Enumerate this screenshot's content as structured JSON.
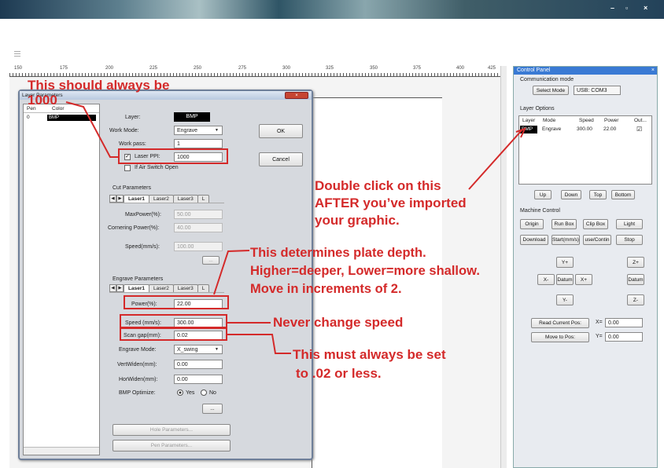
{
  "window": {
    "controls": [
      "–",
      "▫",
      "×"
    ]
  },
  "ruler": {
    "ticks": [
      "150",
      "175",
      "200",
      "225",
      "250",
      "275",
      "300",
      "325",
      "350",
      "375",
      "400",
      "425"
    ]
  },
  "control_panel": {
    "title": "Control Panel",
    "close": "×",
    "comm_mode_label": "Communication mode",
    "select_mode": "Select Mode",
    "port": "USB: COM3",
    "layer_options_label": "Layer Options",
    "layer_headers": [
      "Layer",
      "Mode",
      "Speed",
      "Power",
      "Out..."
    ],
    "layer_row": {
      "layer": "BMP",
      "mode": "Engrave",
      "speed": "300.00",
      "power": "22.00",
      "out": "☑"
    },
    "up": "Up",
    "down": "Down",
    "top": "Top",
    "bottom": "Bottom",
    "machine_control_label": "Machine Control",
    "origin": "Origin",
    "run_box": "Run Box",
    "clip_box": "Clip Box",
    "light": "Light",
    "download": "Download",
    "start": "Start(mm/s)",
    "pause": "use/Contin",
    "stop": "Stop",
    "y_plus": "Y+",
    "z_plus": "Z+",
    "x_minus": "X-",
    "datum": "Datum",
    "x_plus": "X+",
    "datum2": "Datum",
    "y_minus": "Y-",
    "z_minus": "Z-",
    "read_pos": "Read Current Pos:",
    "move_pos": "Move to Pos:",
    "x_label": "X=",
    "x_val": "0.00",
    "y_label": "Y=",
    "y_val": "0.00"
  },
  "dialog": {
    "title": "Layer Parameters",
    "close": "×",
    "pen_header": "Pen",
    "color_header": "Color",
    "pen_row_pen": "0",
    "pen_row_color": "BMP",
    "layer_label": "Layer:",
    "layer_val": "BMP",
    "work_mode_label": "Work Mode:",
    "work_mode_val": "Engrave",
    "work_pass_label": "Work pass:",
    "work_pass_val": "1",
    "laser_ppi_label": "Laser PPI:",
    "laser_ppi_val": "1000",
    "air_switch_label": "If Air Switch Open",
    "ok": "OK",
    "cancel": "Cancel",
    "cut_params_label": "Cut Parameters",
    "tabs": [
      "Laser1",
      "Laser2",
      "Laser3",
      "L"
    ],
    "max_power_label": "MaxPower(%):",
    "max_power_val": "50.00",
    "corner_power_label": "Cornering Power(%):",
    "corner_power_val": "40.00",
    "speed_cut_label": "Speed(mm/s):",
    "speed_cut_val": "100.00",
    "ellipsis": "...",
    "engrave_params_label": "Engrave Parameters",
    "power_label": "Power(%):",
    "power_val": "22.00",
    "speed_label": "Speed (mm/s):",
    "speed_val": "300.00",
    "scan_gap_label": "Scan gap(mm):",
    "scan_gap_val": "0.02",
    "engrave_mode_label": "Engrave Mode:",
    "engrave_mode_val": "X_swing",
    "vert_label": "VertWiden(mm):",
    "vert_val": "0.00",
    "horz_label": "HorWiden(mm):",
    "horz_val": "0.00",
    "bmp_opt_label": "BMP Optimize:",
    "yes": "Yes",
    "no": "No",
    "hole_params": "Hole Parameters...",
    "pen_params": "Pen Parameters..."
  },
  "annotations": {
    "a1_line1": "This should always be",
    "a1_line2": "1000",
    "a2_line1": "Double click on this",
    "a2_line2": "AFTER you’ve imported",
    "a2_line3": "your graphic.",
    "a3_line1": "This determines plate depth.",
    "a3_line2": "Higher=deeper, Lower=more shallow.",
    "a3_line3": "Move in increments of 2.",
    "a4": "Never change speed",
    "a5_line1": "This must always be set",
    "a5_line2": "to .02 or less."
  },
  "colors": {
    "annotation": "#d42a2a",
    "titlebar": "#2f5566",
    "panel_title": "#3a7ad4"
  }
}
